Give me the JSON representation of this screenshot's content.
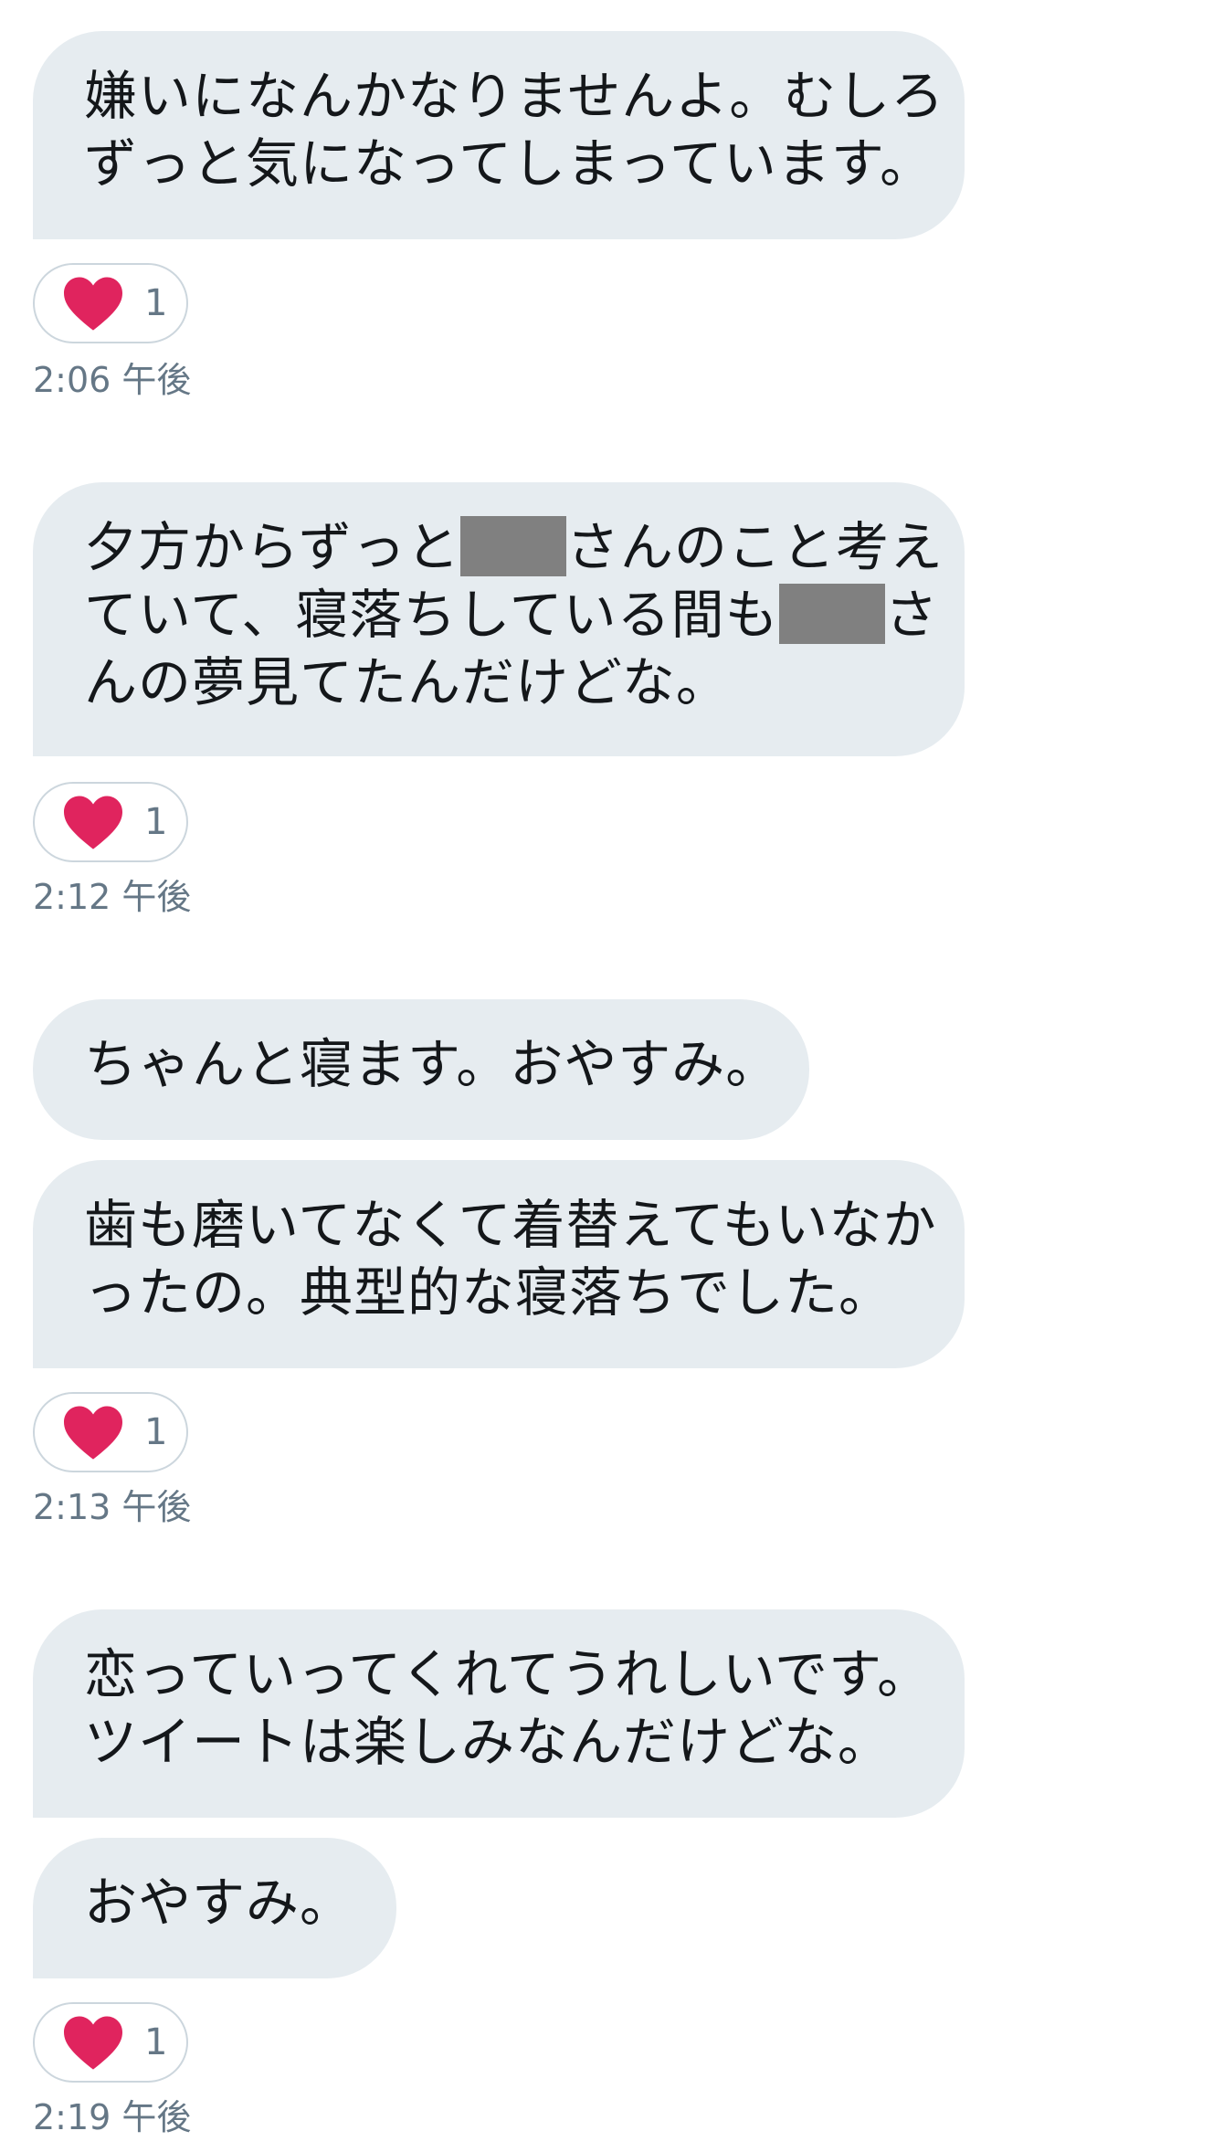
{
  "messages": [
    {
      "lines": [
        "嫌いになんかなりませんよ。むしろ",
        "ずっと気になってしまっています。"
      ]
    },
    {
      "lines": [
        "夕方からずっと",
        "さんのこと考え",
        "ていて、寝落ちしている間も",
        "さ",
        "んの夢見てたんだけどな。"
      ]
    },
    {
      "lines": [
        "ちゃんと寝ます。おやすみ。"
      ]
    },
    {
      "lines": [
        "歯も磨いてなくて着替えてもいなか",
        "ったの。典型的な寝落ちでした。"
      ]
    },
    {
      "lines": [
        "恋っていってくれてうれしいです。",
        "ツイートは楽しみなんだけどな。"
      ]
    },
    {
      "lines": [
        "おやすみ。"
      ]
    }
  ],
  "reactions": [
    {
      "icon": "heart-icon",
      "count": "1",
      "time": "2:06 午後"
    },
    {
      "icon": "heart-icon",
      "count": "1",
      "time": "2:12 午後"
    },
    {
      "icon": "heart-icon",
      "count": "1",
      "time": "2:13 午後"
    },
    {
      "icon": "heart-icon",
      "count": "1",
      "time": "2:19 午後"
    }
  ],
  "colors": {
    "bubble": "#e6ecf0",
    "heart": "#e0245e",
    "meta_text": "#657786",
    "redaction": "#808080"
  }
}
